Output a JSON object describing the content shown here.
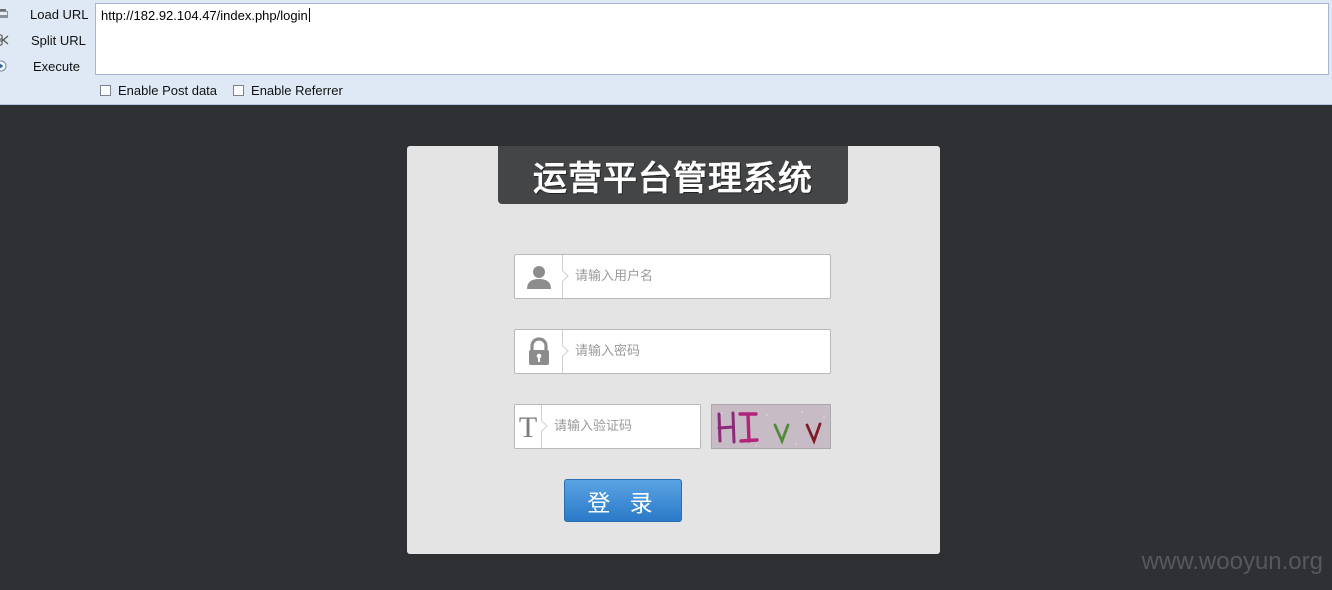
{
  "hackbar": {
    "load_url_label": "Load URL",
    "split_url_label": "Split URL",
    "execute_label": "Execute",
    "url_value": "http://182.92.104.47/index.php/login",
    "enable_post_label": "Enable Post data",
    "enable_referrer_label": "Enable Referrer"
  },
  "login": {
    "title": "运营平台管理系统",
    "username_placeholder": "请输入用户名",
    "password_placeholder": "请输入密码",
    "captcha_placeholder": "请输入验证码",
    "captcha_text": "HI v v",
    "submit_label": "登 录"
  },
  "watermark": "www.wooyun.org",
  "colors": {
    "page_bg": "#2e3034",
    "panel_bg": "#e4e4e4",
    "title_bg": "#444547",
    "button_blue": "#2b7ac8",
    "toolbar_bg": "#dfe9f5"
  },
  "icons": [
    "load-url-icon",
    "split-url-icon",
    "execute-icon",
    "user-icon",
    "lock-icon",
    "text-t-icon"
  ]
}
